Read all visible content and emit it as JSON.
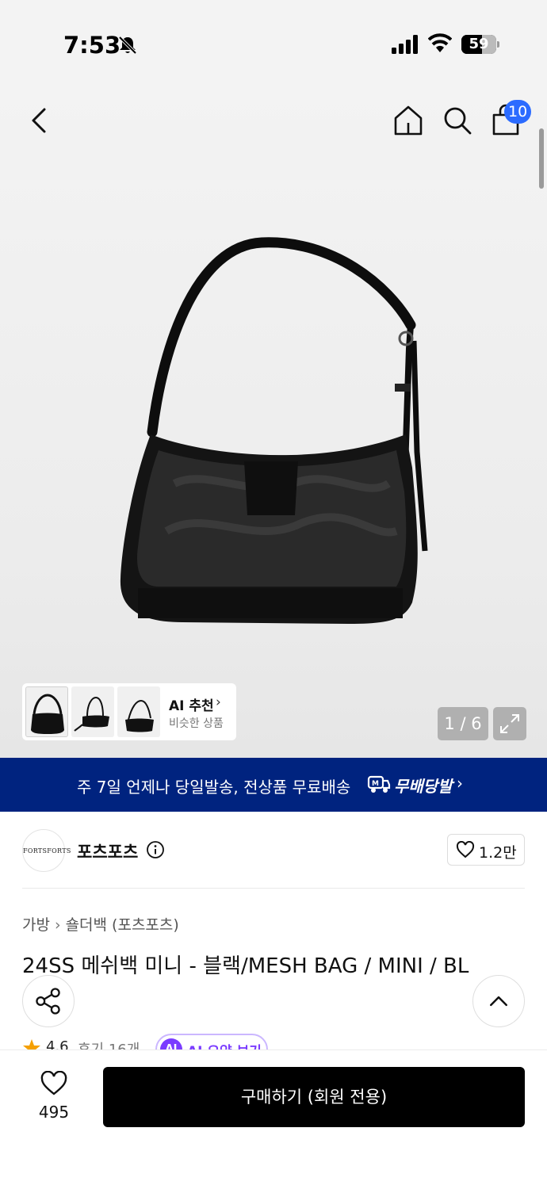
{
  "status_bar": {
    "time": "7:53",
    "battery": "59",
    "battery_level": 0.59
  },
  "header": {
    "cart_count": "10"
  },
  "gallery": {
    "ai_recommend_title": "AI 추천",
    "ai_recommend_subtitle": "비슷한 상품",
    "pager": "1 / 6"
  },
  "banner": {
    "text": "주 7일 언제나 당일발송, 전상품 무료배송",
    "brand": "무배당발",
    "accent_color": "#00237f"
  },
  "brand": {
    "logo_text": "FORTSFORTS",
    "name": "포츠포츠",
    "likes": "1.2만"
  },
  "breadcrumb": {
    "items": [
      "가방",
      "숄더백 (포츠포츠)"
    ]
  },
  "product": {
    "title": "24SS 메쉬백 미니 - 블랙/MESH BAG / MINI / BL",
    "rating": "4.6",
    "reviews": "후기 16개",
    "ai_summary_badge": "AI",
    "ai_summary_label": "AI 요약 보기"
  },
  "bottom_bar": {
    "wish_count": "495",
    "buy_label": "구매하기 (회원 전용)"
  },
  "icons": {
    "back": "back-arrow-icon",
    "home": "home-icon",
    "search": "search-icon",
    "cart": "shopping-bag-icon",
    "share": "share-icon",
    "top": "chevron-up-icon",
    "heart": "heart-icon"
  }
}
